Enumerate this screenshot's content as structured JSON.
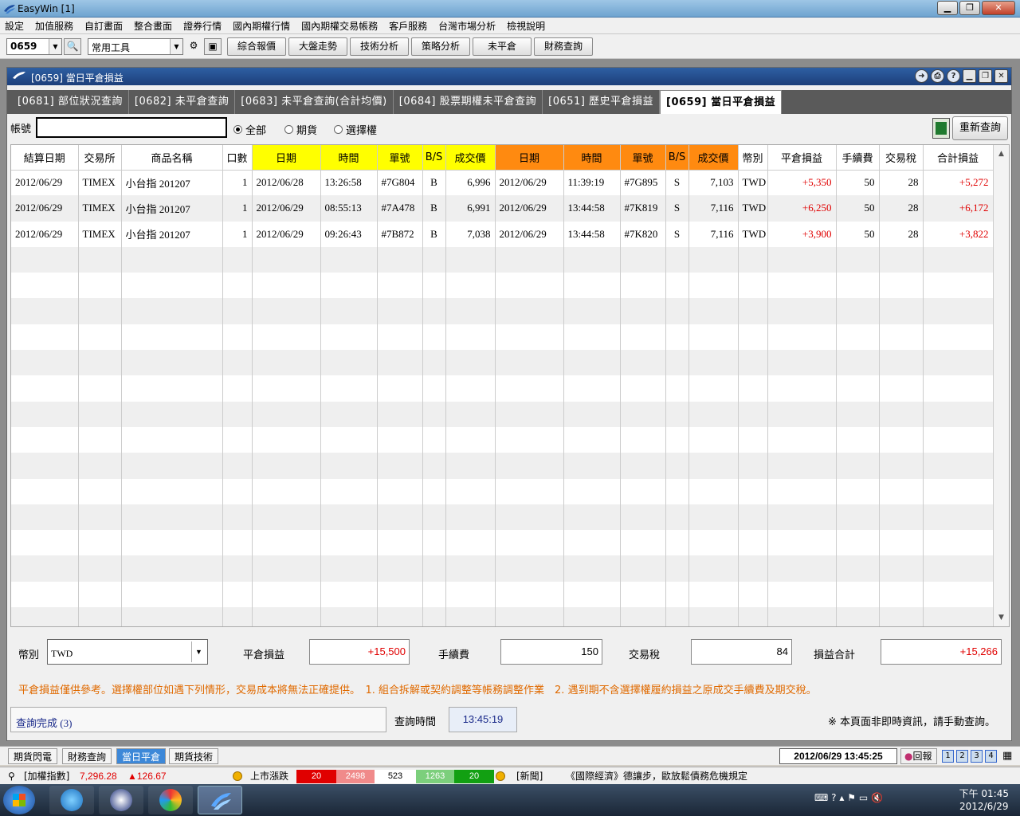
{
  "app": {
    "title": "EasyWin  [1]"
  },
  "menu": [
    "設定",
    "加值服務",
    "自訂畫面",
    "整合畫面",
    "證券行情",
    "國內期權行情",
    "國內期權交易帳務",
    "客戶服務",
    "台灣市場分析",
    "檢視說明"
  ],
  "toolbar": {
    "code": "0659",
    "tools": "常用工具",
    "buttons": [
      "綜合報價",
      "大盤走勢",
      "技術分析",
      "策略分析",
      "未平倉",
      "財務查詢"
    ]
  },
  "window": {
    "title": "[0659] 當日平倉損益",
    "tabs": [
      "[0681] 部位狀況查詢",
      "[0682] 未平倉查詢",
      "[0683] 未平倉查詢(合計均價)",
      "[0684] 股票期權未平倉查詢",
      "[0651] 歷史平倉損益",
      "[0659] 當日平倉損益"
    ]
  },
  "filter": {
    "account_label": "帳號",
    "account_value": "",
    "radios": [
      {
        "label": "全部",
        "selected": true
      },
      {
        "label": "期貨",
        "selected": false
      },
      {
        "label": "選擇權",
        "selected": false
      }
    ],
    "refresh_label": "重新查詢"
  },
  "grid": {
    "headers": [
      "結算日期",
      "交易所",
      "商品名稱",
      "口數",
      "日期",
      "時間",
      "單號",
      "B/S",
      "成交價",
      "日期",
      "時間",
      "單號",
      "B/S",
      "成交價",
      "幣別",
      "平倉損益",
      "手續費",
      "交易稅",
      "合計損益"
    ],
    "header_colors": {
      "open": "#ffff00",
      "close": "#ff8a10"
    },
    "rows": [
      [
        "2012/06/29",
        "TIMEX",
        "小台指 201207",
        "1",
        "2012/06/28",
        "13:26:58",
        "#7G804",
        "B",
        "6,996",
        "2012/06/29",
        "11:39:19",
        "#7G895",
        "S",
        "7,103",
        "TWD",
        "+5,350",
        "50",
        "28",
        "+5,272"
      ],
      [
        "2012/06/29",
        "TIMEX",
        "小台指 201207",
        "1",
        "2012/06/29",
        "08:55:13",
        "#7A478",
        "B",
        "6,991",
        "2012/06/29",
        "13:44:58",
        "#7K819",
        "S",
        "7,116",
        "TWD",
        "+6,250",
        "50",
        "28",
        "+6,172"
      ],
      [
        "2012/06/29",
        "TIMEX",
        "小台指 201207",
        "1",
        "2012/06/29",
        "09:26:43",
        "#7B872",
        "B",
        "7,038",
        "2012/06/29",
        "13:44:58",
        "#7K820",
        "S",
        "7,116",
        "TWD",
        "+3,900",
        "50",
        "28",
        "+3,822"
      ]
    ],
    "empty_rows": 15
  },
  "summary": {
    "currency_label": "幣別",
    "currency_value": "TWD",
    "pnl_label": "平倉損益",
    "pnl_value": "+15,500",
    "fee_label": "手續費",
    "fee_value": "150",
    "tax_label": "交易稅",
    "tax_value": "84",
    "total_label": "損益合計",
    "total_value": "+15,266"
  },
  "notice": "平倉損益僅供參考。選擇權部位如遇下列情形，交易成本將無法正確提供。　1. 組合拆解或契約調整等帳務調整作業　2. 遇到期不含選擇權履約損益之原成交手續費及期交稅。",
  "status": {
    "message": "查詢完成 (3)",
    "query_time_label": "查詢時間",
    "query_time": "13:45:19",
    "warning": "※ 本頁面非即時資訊，請手動查詢。"
  },
  "bottom_tabs": [
    "期貨閃電",
    "財務查詢",
    "當日平倉",
    "期貨技術"
  ],
  "bottom_active": "當日平倉",
  "datetime": "2012/06/29 13:45:25",
  "huibao": "回報",
  "pages": [
    "1",
    "2",
    "3",
    "4"
  ],
  "ticker": {
    "index_label": "[加權指數]",
    "index_value": "7,296.28",
    "index_change": "▲126.67",
    "market_label": "上市漲跌",
    "market_cells": [
      "20",
      "2498",
      "523",
      "1263",
      "20"
    ],
    "market_colors": [
      "#e00000",
      "#f08a8a",
      "#ffffff",
      "#7ccf7c",
      "#12a012"
    ],
    "news_label": "[新聞]",
    "news_text": "《國際經濟》德讓步，歐放鬆債務危機規定"
  },
  "clock": {
    "time": "下午 01:45",
    "date": "2012/6/29"
  }
}
